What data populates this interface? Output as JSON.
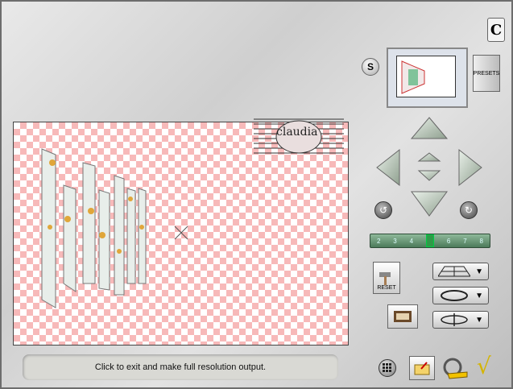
{
  "brand": {
    "logo_glyph": "C"
  },
  "status": {
    "text": "Click to exit and make full resolution output."
  },
  "controls": {
    "s_label": "S",
    "presets_label": "PRESETS",
    "reset_label": "RESET",
    "zoom_marks": [
      "2",
      "3",
      "4",
      "5",
      "6",
      "7",
      "8"
    ],
    "checkmark": "√"
  },
  "watermark": {
    "text": "claudia"
  },
  "colors": {
    "checker": "#f7b9b9",
    "arrow": "#c4d1c4"
  }
}
